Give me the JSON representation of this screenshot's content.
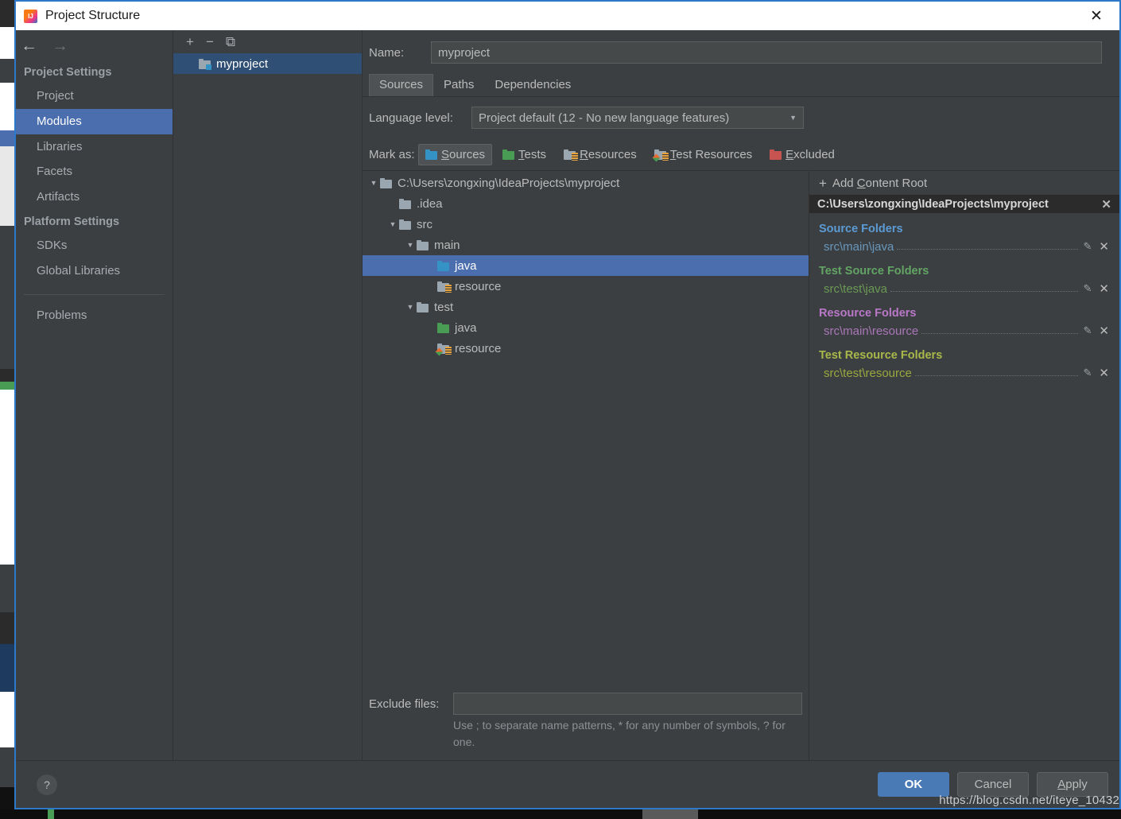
{
  "window": {
    "title": "Project Structure",
    "close_label": "✕",
    "logo_icon": "intellij-idea-logo"
  },
  "leftnav": {
    "back_arrow": "←",
    "forward_arrow": "→",
    "groups": [
      {
        "title": "Project Settings",
        "items": [
          {
            "label": "Project",
            "selected": false
          },
          {
            "label": "Modules",
            "selected": true
          },
          {
            "label": "Libraries",
            "selected": false
          },
          {
            "label": "Facets",
            "selected": false
          },
          {
            "label": "Artifacts",
            "selected": false
          }
        ]
      },
      {
        "title": "Platform Settings",
        "items": [
          {
            "label": "SDKs",
            "selected": false
          },
          {
            "label": "Global Libraries",
            "selected": false
          }
        ]
      }
    ],
    "problems_label": "Problems"
  },
  "modules": {
    "toolbar": {
      "add": "+",
      "remove": "−",
      "copy": "⧉"
    },
    "list": [
      {
        "label": "myproject",
        "icon": "module-folder-icon",
        "selected": true
      }
    ]
  },
  "name_field": {
    "label": "Name:",
    "value": "myproject",
    "placeholder": ""
  },
  "tabs": [
    {
      "label": "Sources",
      "active": true
    },
    {
      "label": "Paths",
      "active": false
    },
    {
      "label": "Dependencies",
      "active": false
    }
  ],
  "language_level": {
    "label": "Language level:",
    "value": "Project default (12 - No new language features)",
    "caret": "▼"
  },
  "mark_as": {
    "label": "Mark as:",
    "buttons": [
      {
        "label": "Sources",
        "mnemonic": "S",
        "rest": "ources",
        "icon": "folder-blue-icon",
        "pressed": true
      },
      {
        "label": "Tests",
        "mnemonic": "T",
        "rest": "ests",
        "icon": "folder-green-icon",
        "pressed": false
      },
      {
        "label": "Resources",
        "mnemonic": "R",
        "rest": "esources",
        "icon": "folder-resource-icon",
        "pressed": false
      },
      {
        "label": "Test Resources",
        "mnemonic": "T",
        "rest": "est Resources",
        "icon": "folder-testres-icon",
        "pressed": false
      },
      {
        "label": "Excluded",
        "mnemonic": "E",
        "rest": "xcluded",
        "icon": "folder-orange-icon",
        "pressed": false
      }
    ]
  },
  "tree": [
    {
      "label": "C:\\Users\\zongxing\\IdeaProjects\\myproject",
      "indent": 0,
      "twisty": "▼",
      "icon": "folder-grey-icon",
      "selected": false
    },
    {
      "label": ".idea",
      "indent": 1,
      "twisty": "",
      "icon": "folder-grey-icon",
      "selected": false
    },
    {
      "label": "src",
      "indent": 1,
      "twisty": "▼",
      "icon": "folder-grey-icon",
      "selected": false
    },
    {
      "label": "main",
      "indent": 2,
      "twisty": "▼",
      "icon": "folder-grey-icon",
      "selected": false
    },
    {
      "label": "java",
      "indent": 3,
      "twisty": "",
      "icon": "folder-blue-icon",
      "selected": true
    },
    {
      "label": "resource",
      "indent": 3,
      "twisty": "",
      "icon": "folder-resource-icon",
      "selected": false
    },
    {
      "label": "test",
      "indent": 2,
      "twisty": "▼",
      "icon": "folder-grey-icon",
      "selected": false
    },
    {
      "label": "java",
      "indent": 3,
      "twisty": "",
      "icon": "folder-green-icon",
      "selected": false
    },
    {
      "label": "resource",
      "indent": 3,
      "twisty": "",
      "icon": "folder-testres-icon",
      "selected": false
    }
  ],
  "exclude": {
    "label": "Exclude files:",
    "value": "",
    "placeholder": "",
    "hint": "Use ; to separate name patterns, * for any number of symbols, ? for one."
  },
  "roots": {
    "add_label": "Add Content Root",
    "add_mnemonic": "C",
    "add_plus": "+",
    "content_root": "C:\\Users\\zongxing\\IdeaProjects\\myproject",
    "content_root_close": "✕",
    "groups": [
      {
        "title": "Source Folders",
        "kind": "src",
        "paths": [
          "src\\main\\java"
        ]
      },
      {
        "title": "Test Source Folders",
        "kind": "test",
        "paths": [
          "src\\test\\java"
        ]
      },
      {
        "title": "Resource Folders",
        "kind": "res",
        "paths": [
          "src\\main\\resource"
        ]
      },
      {
        "title": "Test Resource Folders",
        "kind": "testres",
        "paths": [
          "src\\test\\resource"
        ]
      }
    ],
    "edit_icon": "✎",
    "remove_icon": "✕"
  },
  "bottom": {
    "help_label": "?",
    "ok_label": "OK",
    "cancel_label": "Cancel",
    "apply_label": "Apply",
    "apply_mnemonic": "A",
    "apply_rest": "pply"
  },
  "watermark": "https://blog.csdn.net/iteye_10432",
  "colors": {
    "accent_selection": "#4b6eaf",
    "module_selection": "#2f5074",
    "dialog_border": "#2b79c8",
    "panel_bg": "#3c3f41",
    "primary_button": "#4a7ab5",
    "source_folder": "#6897bb",
    "test_source_folder": "#6a9955",
    "resource_folder": "#a977b8",
    "test_resource_folder": "#9aa83f"
  }
}
